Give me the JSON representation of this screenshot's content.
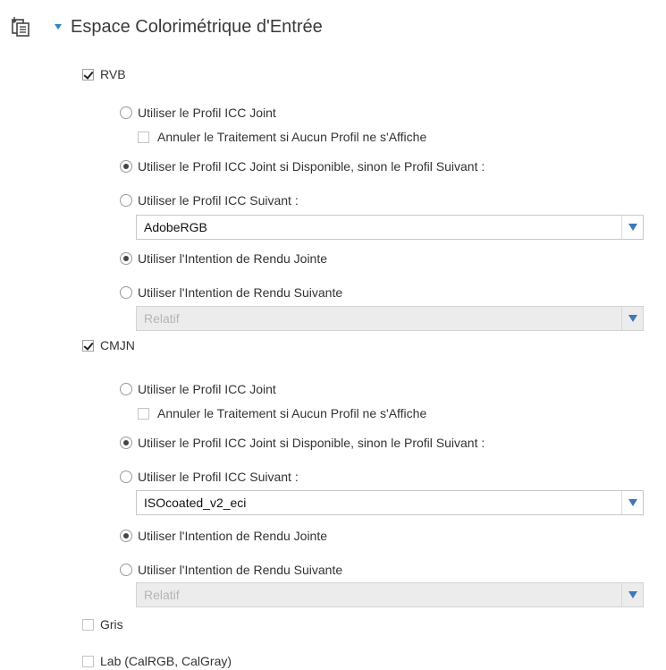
{
  "section": {
    "icon": "import-document-icon",
    "title": "Espace Colorimétrique d'Entrée"
  },
  "rvb": {
    "label": "RVB",
    "checked": true,
    "use_embedded": "Utiliser le Profil ICC Joint",
    "cancel_if_none": "Annuler le Traitement si Aucun Profil ne s'Affiche",
    "use_embedded_else": "Utiliser le Profil ICC Joint si Disponible, sinon le Profil Suivant :",
    "use_following": "Utiliser le Profil ICC Suivant :",
    "profile_value": "AdobeRGB",
    "use_embedded_intent": "Utiliser l'Intention de Rendu Jointe",
    "use_following_intent": "Utiliser l'Intention de Rendu Suivante",
    "intent_value": "Relatif"
  },
  "cmjn": {
    "label": "CMJN",
    "checked": true,
    "use_embedded": "Utiliser le Profil ICC Joint",
    "cancel_if_none": "Annuler le Traitement si Aucun Profil ne s'Affiche",
    "use_embedded_else": "Utiliser le Profil ICC Joint si Disponible, sinon le Profil Suivant :",
    "use_following": "Utiliser le Profil ICC Suivant :",
    "profile_value": "ISOcoated_v2_eci",
    "use_embedded_intent": "Utiliser l'Intention de Rendu Jointe",
    "use_following_intent": "Utiliser l'Intention de Rendu Suivante",
    "intent_value": "Relatif"
  },
  "gris": {
    "label": "Gris",
    "checked": false
  },
  "lab": {
    "label": "Lab (CalRGB, CalGray)",
    "checked": false
  },
  "colors": {
    "accent": "#2b86c5",
    "dropdown_arrow": "#3f77b6",
    "disabled_bg": "#ececec"
  }
}
